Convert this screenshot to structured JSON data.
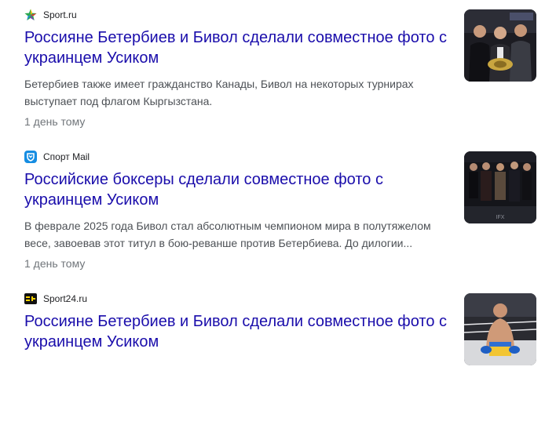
{
  "results": [
    {
      "source": "Sport.ru",
      "favicon": "sport-ru-star-icon",
      "title": "Россияне Бетербиев и Бивол сделали совместное фото с украинцем Усиком",
      "snippet": "Бетербиев также имеет гражданство Канады, Бивол на некоторых турнирах выступает под флагом Кыргызстана.",
      "time": "1 день тому",
      "thumbnail": "boxers-faceoff-photo"
    },
    {
      "source": "Спорт Mail",
      "favicon": "sport-mail-shield-icon",
      "title": "Российские боксеры сделали совместное фото с украинцем Усиком",
      "snippet": "В феврале 2025 года Бивол стал абсолютным чемпионом мира в полутяжелом весе, завоевав этот титул в бою-реванше против Бетербиева. До дилогии...",
      "time": "1 день тому",
      "thumbnail": "boxers-group-ring-photo"
    },
    {
      "source": "Sport24.ru",
      "favicon": "sport24-icon",
      "title": "Россияне Бетербиев и Бивол сделали совместное фото с украинцем Усиком",
      "snippet": "",
      "time": "",
      "thumbnail": "boxer-celebrating-photo"
    }
  ],
  "colors": {
    "title_link": "#1a0dab",
    "snippet": "#4d5156",
    "timestamp": "#70757a",
    "source": "#202124"
  }
}
